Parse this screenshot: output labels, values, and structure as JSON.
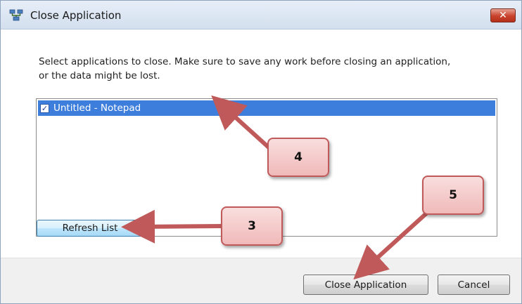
{
  "window": {
    "title": "Close Application",
    "close_glyph": "✕",
    "app_icon": "network-computers-icon"
  },
  "instructions": "Select applications to close. Make sure to save any work before closing an application, or the data might be lost.",
  "app_list": {
    "items": [
      {
        "label": "Untitled - Notepad",
        "checked": true,
        "selected": true
      }
    ]
  },
  "buttons": {
    "refresh": "Refresh List",
    "close_app": "Close Application",
    "cancel": "Cancel"
  },
  "annotations": {
    "callout_3": "3",
    "callout_4": "4",
    "callout_5": "5",
    "color": "#c05a5a"
  },
  "colors": {
    "selection": "#3d7edc",
    "close_button": "#c8412b"
  }
}
